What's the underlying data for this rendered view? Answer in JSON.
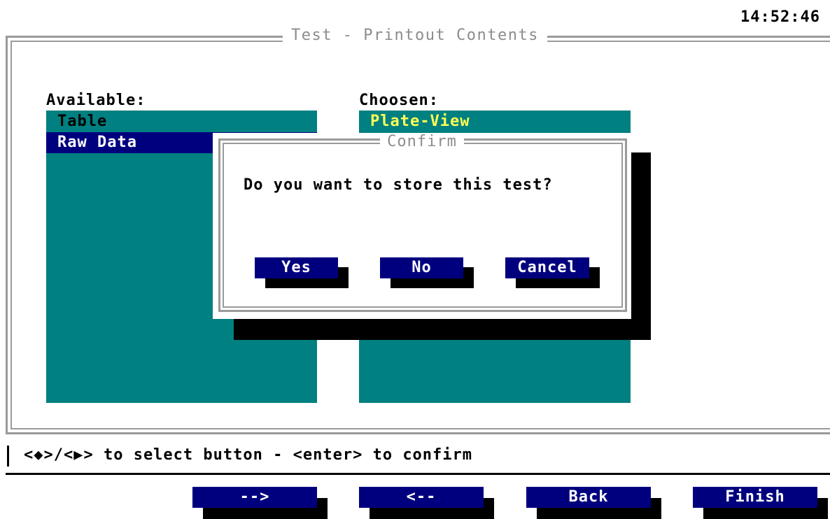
{
  "clock": "14:52:46",
  "window": {
    "title": "Test - Printout Contents"
  },
  "available": {
    "label": "Available:",
    "items": [
      "Table",
      "Raw Data"
    ]
  },
  "chosen": {
    "label": "Choosen:",
    "items": [
      "Plate-View"
    ]
  },
  "dialog": {
    "title": "Confirm",
    "message": "Do you want to store this test?",
    "buttons": {
      "yes": "Yes",
      "no": "No",
      "cancel": "Cancel"
    }
  },
  "hint": "<◆>/<▶> to select button - <enter> to confirm",
  "footer": {
    "add": "-->",
    "remove": "<--",
    "back": "Back",
    "finish": "Finish"
  },
  "colors": {
    "panel": "#008080",
    "button": "#00007e",
    "highlight_text": "#ffff55",
    "frame": "#9a9a9a"
  }
}
